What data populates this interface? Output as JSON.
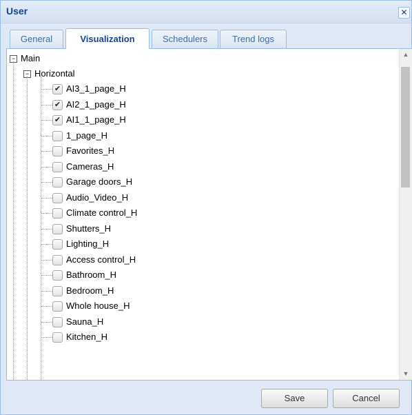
{
  "window": {
    "title": "User",
    "close_icon": "close-icon"
  },
  "tabs": [
    {
      "label": "General",
      "active": false
    },
    {
      "label": "Visualization",
      "active": true
    },
    {
      "label": "Schedulers",
      "active": false
    },
    {
      "label": "Trend logs",
      "active": false
    }
  ],
  "tree": {
    "root": {
      "label": "Main",
      "expanded": true
    },
    "group": {
      "label": "Horizontal",
      "expanded": true
    },
    "items": [
      {
        "label": "AI3_1_page_H",
        "checked": true
      },
      {
        "label": "AI2_1_page_H",
        "checked": true
      },
      {
        "label": "AI1_1_page_H",
        "checked": true
      },
      {
        "label": "1_page_H",
        "checked": false
      },
      {
        "label": "Favorites_H",
        "checked": false
      },
      {
        "label": "Cameras_H",
        "checked": false
      },
      {
        "label": "Garage doors_H",
        "checked": false
      },
      {
        "label": "Audio_Video_H",
        "checked": false
      },
      {
        "label": "Climate control_H",
        "checked": false
      },
      {
        "label": "Shutters_H",
        "checked": false
      },
      {
        "label": "Lighting_H",
        "checked": false
      },
      {
        "label": "Access control_H",
        "checked": false
      },
      {
        "label": "Bathroom_H",
        "checked": false
      },
      {
        "label": "Bedroom_H",
        "checked": false
      },
      {
        "label": "Whole house_H",
        "checked": false
      },
      {
        "label": "Sauna_H",
        "checked": false
      },
      {
        "label": "Kitchen_H",
        "checked": false
      }
    ]
  },
  "footer": {
    "save_label": "Save",
    "cancel_label": "Cancel"
  },
  "colors": {
    "title_text": "#15428b",
    "border": "#99bbe8",
    "window_bg": "#dfe8f6"
  }
}
